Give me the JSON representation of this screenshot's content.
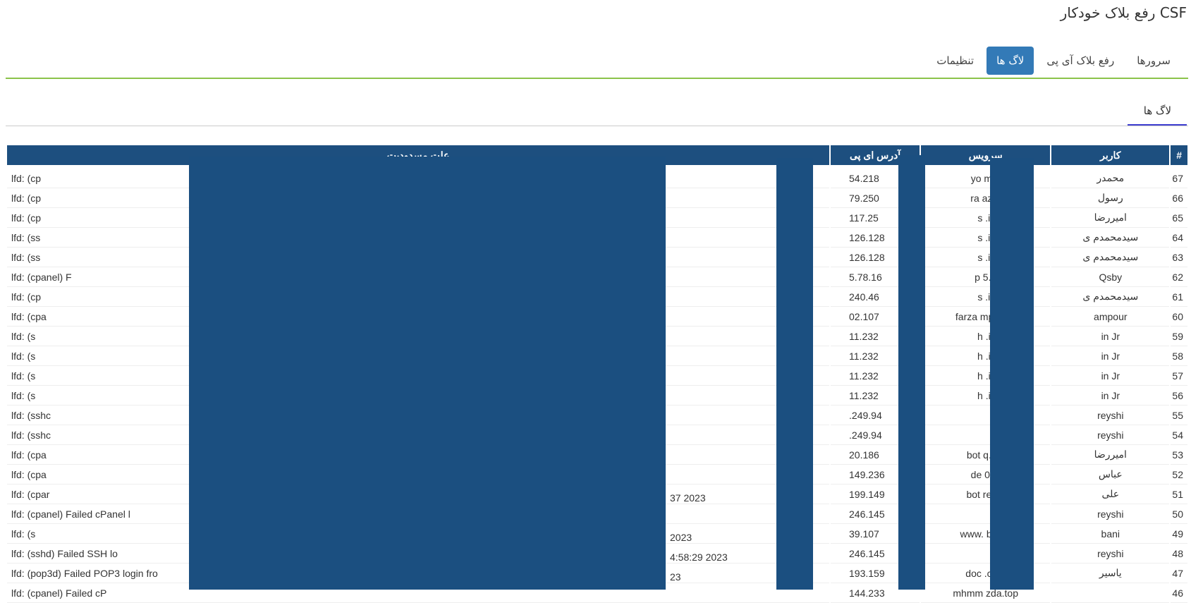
{
  "page_title": "رفع بلاک خودکار CSF",
  "tabs": [
    {
      "label": "سرورها"
    },
    {
      "label": "رفع بلاک آی پی"
    },
    {
      "label": "لاگ ها",
      "active": true
    },
    {
      "label": "تنظیمات"
    }
  ],
  "section_tab": "لاگ ها",
  "table": {
    "columns": [
      "#",
      "کاربر",
      "سرویس",
      "آدرس ای پی",
      "علت مسدودیت"
    ],
    "rows": [
      {
        "num": "67",
        "user": "محمدر",
        "service": "yo            m.ir",
        "ip": "54.218",
        "reason": "lfd: (cp"
      },
      {
        "num": "66",
        "user": "رسول",
        "service": "ra           az.ir",
        "ip": "79.250",
        "reason": "lfd: (cp"
      },
      {
        "num": "65",
        "user": "امیررضا",
        "service": "s          .ir",
        "ip": "117.25",
        "reason": "lfd: (cp"
      },
      {
        "num": "64",
        "user": "سیدمحمدم                     ی",
        "service": "s          .ir",
        "ip": "126.128",
        "reason": "lfd: (ss"
      },
      {
        "num": "63",
        "user": "سیدمحمدم                     ی",
        "service": "s          .ir",
        "ip": "126.128",
        "reason": "lfd: (ss"
      },
      {
        "num": "62",
        "user": "Qsby",
        "service": "p            5.ir",
        "ip": "5.78.16",
        "reason": "lfd: (cpanel) F"
      },
      {
        "num": "61",
        "user": "سیدمحمدم                     ی",
        "service": "s          .ir",
        "ip": "240.46",
        "reason": "lfd: (cp"
      },
      {
        "num": "60",
        "user": "ampour",
        "service": "farza            mpour.ir",
        "ip": "02.107",
        "reason": "lfd: (cpa"
      },
      {
        "num": "59",
        "user": "in Jr",
        "service": "h           .ir",
        "ip": "11.232",
        "reason": "lfd: (s"
      },
      {
        "num": "58",
        "user": "in Jr",
        "service": "h           .ir",
        "ip": "11.232",
        "reason": "lfd: (s"
      },
      {
        "num": "57",
        "user": "in Jr",
        "service": "h           .ir",
        "ip": "11.232",
        "reason": "lfd: (s"
      },
      {
        "num": "56",
        "user": "in Jr",
        "service": "h           .ir",
        "ip": "11.232",
        "reason": "lfd: (s"
      },
      {
        "num": "55",
        "user": "reyshi",
        "service": "",
        "ip": ".249.94",
        "reason": "lfd: (sshc"
      },
      {
        "num": "54",
        "user": "reyshi",
        "service": "",
        "ip": ".249.94",
        "reason": "lfd: (sshc"
      },
      {
        "num": "53",
        "user": "امیررضا",
        "service": "bot          q.cfd",
        "ip": "20.186",
        "reason": "lfd: (cpa"
      },
      {
        "num": "52",
        "user": "عباس",
        "service": "de         0l.ir",
        "ip": "149.236",
        "reason": "lfd: (cpa"
      },
      {
        "num": "51",
        "user": "علی",
        "service": "bot          res.ir",
        "ip": "199.149",
        "reason": "lfd: (cpar"
      },
      {
        "num": "50",
        "user": "reyshi",
        "service": "",
        "ip": "246.145",
        "reason": "lfd: (cpanel) Failed cPanel l"
      },
      {
        "num": "49",
        "user": "bani",
        "service": "www.          bad.ir",
        "ip": "39.107",
        "reason": "lfd: (s"
      },
      {
        "num": "48",
        "user": "reyshi",
        "service": "",
        "ip": "246.145",
        "reason": "lfd: (sshd) Failed SSH lo"
      },
      {
        "num": "47",
        "user": "یاسیر",
        "service": "doc          .com",
        "ip": "193.159",
        "reason": "lfd: (pop3d) Failed POP3 login fro"
      },
      {
        "num": "46",
        "user": "",
        "service": "mhmm         zda.top",
        "ip": "144.233",
        "reason": "lfd: (cpanel) Failed cP"
      }
    ],
    "reason_tails": [
      {
        "row": 17,
        "text": "37 2023"
      },
      {
        "row": 19,
        "text": "2023"
      },
      {
        "row": 20,
        "text": "4:58:29 2023"
      },
      {
        "row": 21,
        "text": "23"
      }
    ]
  },
  "colors": {
    "accent": "#337ab7",
    "header_bg": "#1d4f7f",
    "redaction": "#1b4f80",
    "tab_rule": "#8bc34a"
  }
}
